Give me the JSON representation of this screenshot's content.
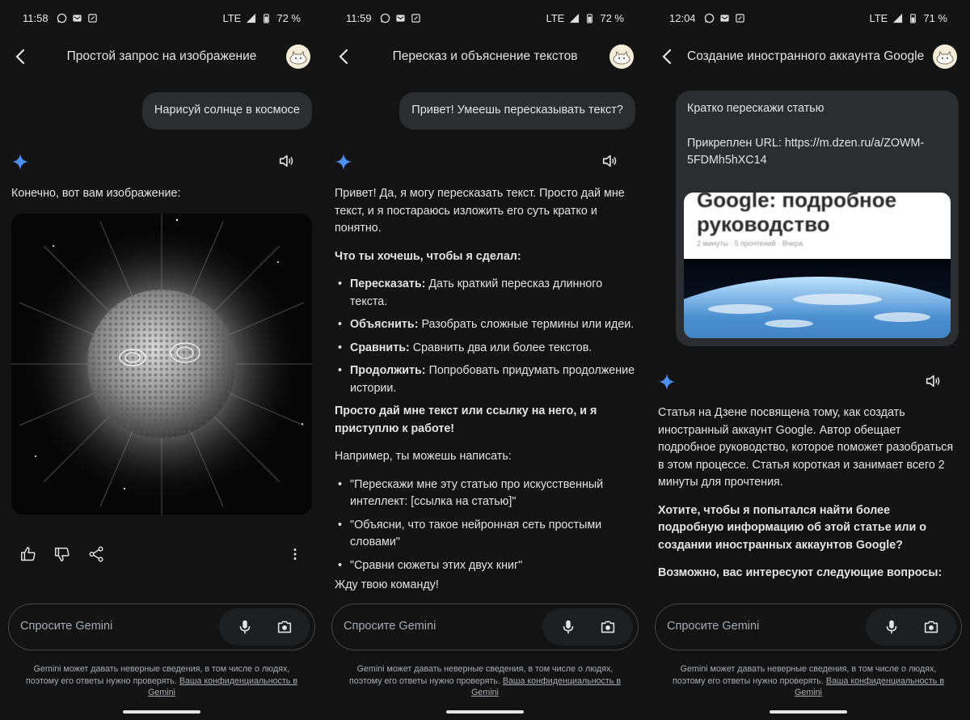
{
  "screens": [
    {
      "status": {
        "time": "11:58",
        "network": "LTE",
        "battery": "72 %"
      },
      "title": "Простой запрос на изображение",
      "user_message": "Нарисуй солнце в космосе",
      "response_intro": "Конечно, вот вам изображение:",
      "image_icon": "sun-in-space-image"
    },
    {
      "status": {
        "time": "11:59",
        "network": "LTE",
        "battery": "72 %"
      },
      "title": "Пересказ и объяснение текстов",
      "user_message": "Привет! Умеешь пересказывать текст?",
      "response": {
        "intro": "Привет! Да, я могу пересказать текст. Просто дай мне текст, и я постараюсь изложить его суть кратко и понятно.",
        "question": "Что ты хочешь, чтобы я сделал:",
        "options": [
          {
            "term": "Пересказать:",
            "desc": "Дать краткий пересказ длинного текста."
          },
          {
            "term": "Объяснить:",
            "desc": "Разобрать сложные термины или идеи."
          },
          {
            "term": "Сравнить:",
            "desc": "Сравнить два или более текстов."
          },
          {
            "term": "Продолжить:",
            "desc": "Попробовать придумать продолжение истории."
          }
        ],
        "cta": "Просто дай мне текст или ссылку на него, и я приступлю к работе!",
        "example_intro": "Например, ты можешь написать:",
        "examples": [
          "\"Перескажи мне эту статью про искусственный интеллект: [ссылка на статью]\"",
          "\"Объясни, что такое нейронная сеть простыми словами\"",
          "\"Сравни сюжеты этих двух книг\""
        ],
        "closing": "Жду твою команду!"
      }
    },
    {
      "status": {
        "time": "12:04",
        "network": "LTE",
        "battery": "71 %"
      },
      "title": "Создание иностранного аккаунта Google",
      "user_message": "Кратко перескажи статью",
      "attachment_label": "Прикреплен URL: https://m.dzen.ru/a/ZOWM-5FDMh5hXC14",
      "link_preview": {
        "title": "Google: подробное руководство",
        "meta": "2 минуты · 5 прочтений · Вчера"
      },
      "response": {
        "summary": "Статья на Дзене посвящена тому, как создать иностранный аккаунт Google. Автор обещает подробное руководство, которое поможет разобраться в этом процессе. Статья короткая и занимает всего 2 минуты для прочтения.",
        "question": "Хотите, чтобы я попытался найти более подробную информацию об этой статье или о создании иностранных аккаунтов Google?",
        "follow": "Возможно, вас интересуют следующие вопросы:"
      }
    }
  ],
  "input": {
    "placeholder": "Спросите Gemini"
  },
  "disclaimer": {
    "text": "Gemini может давать неверные сведения, в том числе о людях, поэтому его ответы нужно проверять.",
    "link": "Ваша конфиденциальность в Gemini"
  },
  "colors": {
    "background": "#131314",
    "bubble": "#2c2d30",
    "accent_star": "#4c8df6",
    "text": "#e3e3e3"
  }
}
